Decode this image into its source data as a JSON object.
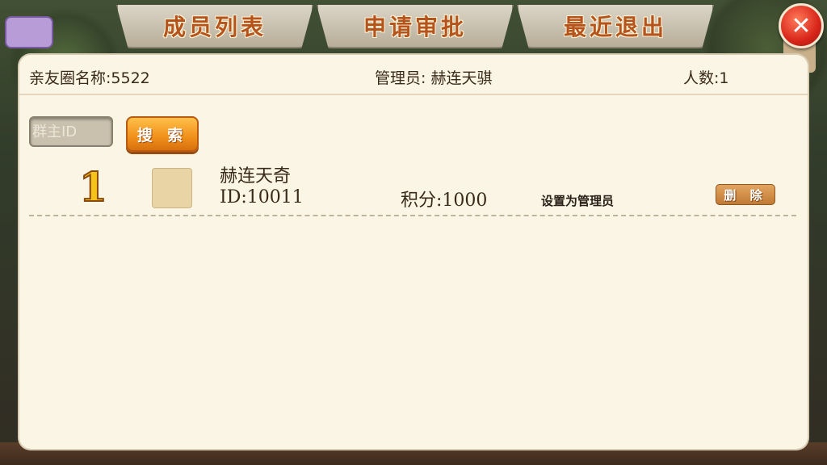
{
  "tabs": [
    {
      "label": "成员列表"
    },
    {
      "label": "申请审批"
    },
    {
      "label": "最近退出"
    }
  ],
  "close_label": "✕",
  "info": {
    "circle_name": "亲友圈名称:5522",
    "admin": "管理员:  赫连天骐",
    "count": "人数:1"
  },
  "search": {
    "placeholder": "群主ID",
    "button_label": "搜 索"
  },
  "members": [
    {
      "rank": "1",
      "name": "赫连天奇",
      "id": "ID:10011",
      "score": "积分:1000",
      "set_admin_label": "设置为管理员",
      "delete_label": "删 除"
    }
  ],
  "colors": {
    "tab_text": "#b4541c",
    "panel_bg": "#fbf5e6",
    "search_button": "#f0901a",
    "close_button": "#d8251a"
  }
}
